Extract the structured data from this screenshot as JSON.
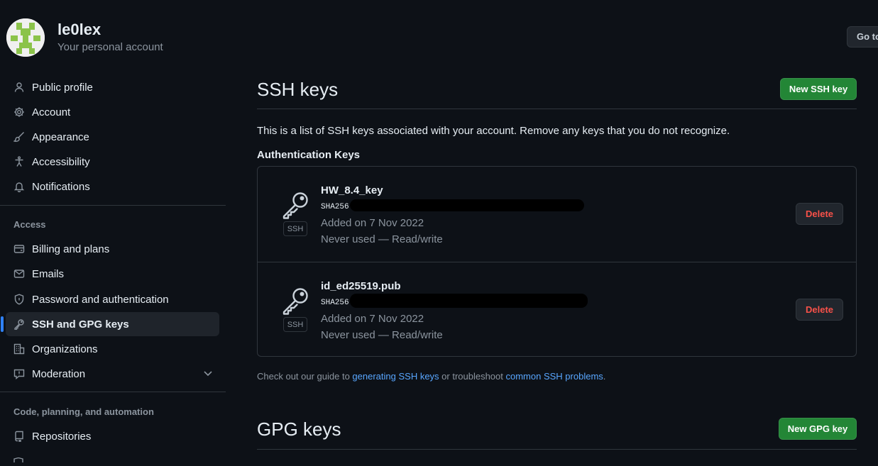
{
  "profile": {
    "username": "le0lex",
    "subtitle": "Your personal account",
    "goto_label": "Go to your personal profile"
  },
  "sidebar": {
    "items": [
      {
        "label": "Public profile",
        "icon": "person-icon"
      },
      {
        "label": "Account",
        "icon": "gear-icon"
      },
      {
        "label": "Appearance",
        "icon": "paintbrush-icon"
      },
      {
        "label": "Accessibility",
        "icon": "accessibility-icon"
      },
      {
        "label": "Notifications",
        "icon": "bell-icon"
      }
    ],
    "access_heading": "Access",
    "access_items": [
      {
        "label": "Billing and plans",
        "icon": "credit-card-icon"
      },
      {
        "label": "Emails",
        "icon": "mail-icon"
      },
      {
        "label": "Password and authentication",
        "icon": "shield-lock-icon"
      },
      {
        "label": "SSH and GPG keys",
        "icon": "key-icon",
        "active": true
      },
      {
        "label": "Organizations",
        "icon": "organization-icon"
      },
      {
        "label": "Moderation",
        "icon": "report-icon"
      }
    ],
    "code_heading": "Code, planning, and automation",
    "code_items": [
      {
        "label": "Repositories",
        "icon": "repo-icon"
      }
    ]
  },
  "ssh": {
    "title": "SSH keys",
    "new_button": "New SSH key",
    "intro": "This is a list of SSH keys associated with your account. Remove any keys that you do not recognize.",
    "auth_heading": "Authentication Keys",
    "keys": [
      {
        "title": "HW_8.4_key",
        "fingerprint": "SHA256",
        "added": "Added on 7 Nov 2022",
        "usage": "Never used — Read/write",
        "badge": "SSH",
        "delete": "Delete"
      },
      {
        "title": "id_ed25519.pub",
        "fingerprint": "SHA256",
        "added": "Added on 7 Nov 2022",
        "usage": "Never used — Read/write",
        "badge": "SSH",
        "delete": "Delete"
      }
    ],
    "guide": {
      "prefix": "Check out our guide to ",
      "link1": "generating SSH keys",
      "middle": " or troubleshoot ",
      "link2": "common SSH problems",
      "suffix": "."
    }
  },
  "gpg": {
    "title": "GPG keys",
    "new_button": "New GPG key"
  },
  "colors": {
    "background": "#0d1117",
    "accent": "#2f81f7",
    "primary_button": "#238636",
    "danger": "#f85149",
    "link": "#58a6ff"
  }
}
